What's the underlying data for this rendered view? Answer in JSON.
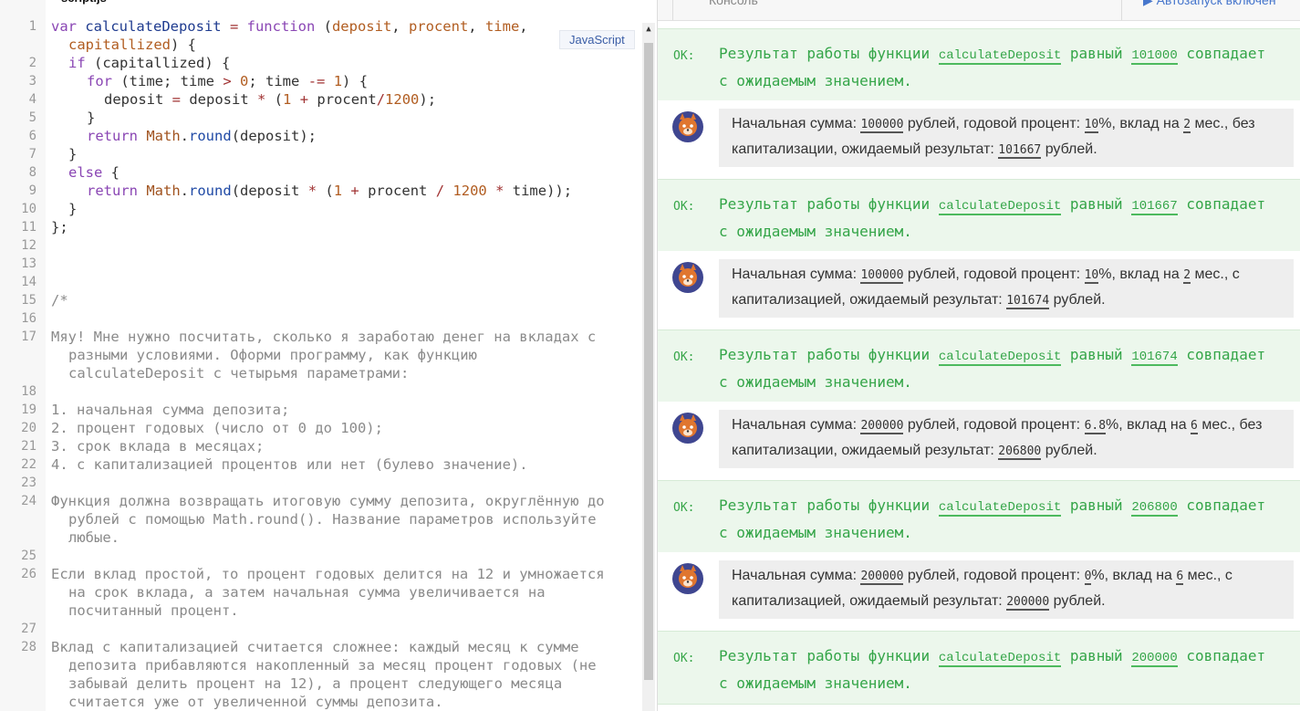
{
  "editor": {
    "file_tab": "script.js",
    "language_badge": "JavaScript",
    "line_numbers": [
      "1",
      "2",
      "3",
      "4",
      "5",
      "6",
      "7",
      "8",
      "9",
      "10",
      "11",
      "12",
      "13",
      "14",
      "15",
      "16",
      "17",
      "18",
      "19",
      "20",
      "21",
      "22",
      "23",
      "24",
      "25",
      "26",
      "27",
      "28"
    ],
    "code": {
      "l1": {
        "a": "var ",
        "b": "calculateDeposit",
        "c": " = ",
        "d": "function",
        "e": " (",
        "f": "deposit",
        "g": ", ",
        "h": "procent",
        "i": ", ",
        "j": "time",
        "k": ","
      },
      "l1b": {
        "a": "capitallized",
        "b": ") {"
      },
      "l2": {
        "a": "if",
        "b": " (capitallized) {"
      },
      "l3": {
        "a": "for",
        "b": " (time; time ",
        "c": ">",
        "d": " ",
        "e": "0",
        "f": "; time ",
        "g": "-=",
        "h": " ",
        "i": "1",
        "j": ") {"
      },
      "l4": {
        "a": "deposit ",
        "b": "=",
        "c": " deposit ",
        "d": "*",
        "e": " (",
        "f": "1",
        "g": " ",
        "h": "+",
        "i": " procent",
        "j": "/",
        "k": "1200",
        "l": ");"
      },
      "l5": "}",
      "l6": {
        "a": "return",
        "b": " ",
        "c": "Math",
        "d": ".",
        "e": "round",
        "f": "(deposit);"
      },
      "l7": "}",
      "l8": {
        "a": "else",
        "b": " {"
      },
      "l9": {
        "a": "return",
        "b": " ",
        "c": "Math",
        "d": ".",
        "e": "round",
        "f": "(deposit ",
        "g": "*",
        "h": " (",
        "i": "1",
        "j": " ",
        "k": "+",
        "l": " procent ",
        "m": "/",
        "n": " ",
        "o": "1200",
        "p": " ",
        "q": "*",
        "r": " time));"
      },
      "l10": "}",
      "l11": "};",
      "l15": "/*",
      "l17a": "Мяу! Мне нужно посчитать, сколько я заработаю денег на вкладах с",
      "l17b": "разными условиями. Оформи программу, как функцию",
      "l17c": "calculateDeposit с четырьмя параметрами:",
      "l19": "1. начальная сумма депозита;",
      "l20": "2. процент годовых (число от 0 до 100);",
      "l21": "3. срок вклада в месяцах;",
      "l22": "4. с капитализацией процентов или нет (булево значение).",
      "l24a": "Функция должна возвращать итоговую сумму депозита, округлённую до",
      "l24b": "рублей с помощью Math.round(). Название параметров используйте",
      "l24c": "любые.",
      "l26a": "Если вклад простой, то процент годовых делится на 12 и умножается",
      "l26b": "на срок вклада, а затем начальная сумма увеличивается на",
      "l26c": "посчитанный процент.",
      "l28a": "Вклад с капитализацией считается сложнее: каждый месяц к сумме",
      "l28b": "депозита прибавляются накопленный за месяц процент годовых (не",
      "l28c": "забывай делить процент на 12), а процент следующего месяца",
      "l28d": "считается уже от увеличенной суммы депозита."
    }
  },
  "console": {
    "title": "Консоль",
    "autorun": "▶  Автозапуск включен",
    "ok_label": "OK:",
    "ok_prefix": "Результат работы функции",
    "ok_func": "calculateDeposit",
    "ok_equal": "равный",
    "ok_suffix": "совпадает",
    "ok_line2": "с ожидаемым значением.",
    "ok_values": [
      "101000",
      "101667",
      "101674",
      "206800",
      "200000"
    ],
    "messages": [
      {
        "t1": "Начальная сумма: ",
        "sum": "100000",
        "t2": " рублей, годовой процент: ",
        "pct": "10",
        "t3": "%, вклад на ",
        "months": "2",
        "t4": " мес., без капитализации, ожидаемый результат: ",
        "result": "101667",
        "t5": " рублей."
      },
      {
        "t1": "Начальная сумма: ",
        "sum": "100000",
        "t2": " рублей, годовой процент: ",
        "pct": "10",
        "t3": "%, вклад на ",
        "months": "2",
        "t4": " мес., с капитализацией, ожидаемый результат: ",
        "result": "101674",
        "t5": " рублей."
      },
      {
        "t1": "Начальная сумма: ",
        "sum": "200000",
        "t2": " рублей, годовой процент: ",
        "pct": "6.8",
        "t3": "%, вклад на ",
        "months": "6",
        "t4": " мес., без капитализации, ожидаемый результат: ",
        "result": "206800",
        "t5": " рублей."
      },
      {
        "t1": "Начальная сумма: ",
        "sum": "200000",
        "t2": " рублей, годовой процент: ",
        "pct": "0",
        "t3": "%, вклад на ",
        "months": "6",
        "t4": " мес., с капитализацией, ожидаемый результат: ",
        "result": "200000",
        "t5": " рублей."
      }
    ]
  },
  "colors": {
    "ok_bg": "#ecf7ec",
    "ok_text": "#34a548",
    "avatar_bg": "#3f4690",
    "cat_orange": "#e0762f"
  }
}
